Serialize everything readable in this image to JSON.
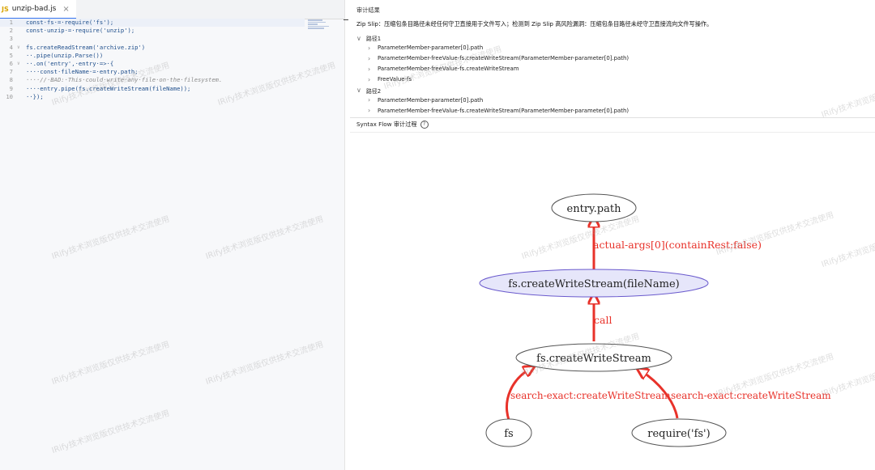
{
  "editor": {
    "tab": {
      "icon": "JS",
      "file_name": "unzip-bad.js",
      "close": "×"
    },
    "lines": [
      {
        "no": "1",
        "text": "const·fs·=·require('fs');",
        "fold": ""
      },
      {
        "no": "2",
        "text": "const·unzip·=·require('unzip');",
        "fold": ""
      },
      {
        "no": "3",
        "text": "",
        "fold": ""
      },
      {
        "no": "4",
        "text": "fs.createReadStream('archive.zip')",
        "fold": "∨"
      },
      {
        "no": "5",
        "text": "··.pipe(unzip.Parse())",
        "fold": ""
      },
      {
        "no": "6",
        "text": "··.on('entry',·entry·=>·{",
        "fold": "∨"
      },
      {
        "no": "7",
        "text": "····const·fileName·=·entry.path;",
        "fold": ""
      },
      {
        "no": "8",
        "text": "····//·BAD:·This·could·write·any·file·on·the·filesystem.",
        "fold": ""
      },
      {
        "no": "9",
        "text": "····entry.pipe(fs.createWriteStream(fileName));",
        "fold": ""
      },
      {
        "no": "10",
        "text": "··});",
        "fold": ""
      }
    ]
  },
  "audit": {
    "title": "审计结果",
    "description": "Zip Slip：压缩包条目路径未经任何守卫直接用于文件写入；检测到 Zip Slip 高风险漏洞：压缩包条目路径未经守卫直接流向文件写操作。",
    "paths": [
      {
        "label": "路径1",
        "items": [
          "ParameterMember-parameter[0].path",
          "ParameterMember-freeValue-fs.createWriteStream(ParameterMember-parameter[0].path)",
          "ParameterMember-freeValue-fs.createWriteStream",
          "FreeValue-fs"
        ]
      },
      {
        "label": "路径2",
        "items": [
          "ParameterMember-parameter[0].path",
          "ParameterMember-freeValue-fs.createWriteStream(ParameterMember-parameter[0].path)"
        ]
      }
    ]
  },
  "syntax_flow": {
    "header": "Syntax Flow 审计过程",
    "help_icon": "?",
    "nodes": {
      "entry_path": "entry.path",
      "write_stream_call": "fs.createWriteStream(fileName)",
      "write_stream": "fs.createWriteStream",
      "fs": "fs",
      "require_fs": "require('fs')"
    },
    "edges": {
      "actual_args": "actual-args[0](containRest:false)",
      "call": "call",
      "search_left": "search-exact:createWriteStream",
      "search_right": "search-exact:createWriteStream"
    },
    "colors": {
      "edge": "#e8322a",
      "highlight_node_fill": "#e6e6fa",
      "highlight_node_stroke": "#6a5acd",
      "node_stroke": "#555555"
    }
  },
  "watermark": "IRify技术浏览版仅供技术交流使用"
}
